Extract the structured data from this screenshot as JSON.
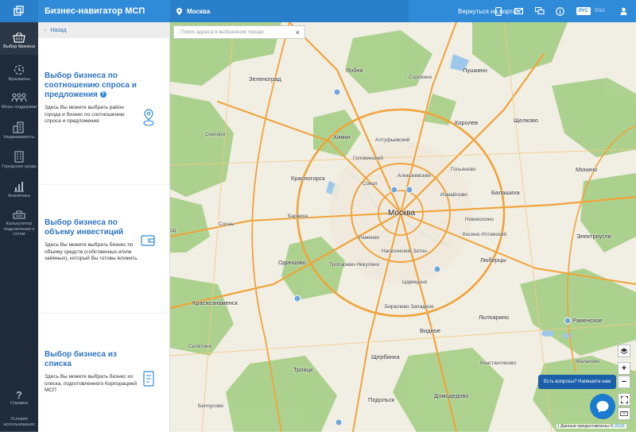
{
  "topbar": {
    "app_title": "Бизнес-навигатор МСП",
    "city": "Москва",
    "back_to_portal": "Вернуться на портал",
    "lang_active": "РУС",
    "lang_inactive": "ENG"
  },
  "sidebar": {
    "items": [
      {
        "label": "Выбор бизнеса"
      },
      {
        "label": "Франшизы"
      },
      {
        "label": "Меры поддержки"
      },
      {
        "label": "Недвижимость"
      },
      {
        "label": "Городская среда"
      },
      {
        "label": "Аналитика"
      },
      {
        "label": "Калькулятор подключения к сетям"
      }
    ],
    "bottom": [
      {
        "label": "Справка"
      },
      {
        "label": "Условия использования"
      }
    ]
  },
  "panel": {
    "back": "Назад",
    "cards": [
      {
        "title": "Выбор бизнеса по соотношению спроса и предложения",
        "desc": "Здесь Вы можете выбрать район города и бизнес по соотношению спроса и предложения"
      },
      {
        "title": "Выбор бизнеса по объему инвестиций",
        "desc": "Здесь Вы можете выбрать бизнес по объему средств (собственных и/или заёмных), который Вы готовы вложить"
      },
      {
        "title": "Выбор бизнеса из списка",
        "desc": "Здесь Вы можете выбрать бизнес из списка, подготовленного Корпорацией МСП"
      }
    ]
  },
  "map": {
    "search_placeholder": "Поиск адреса в выбранном городе",
    "labels": {
      "zelenograd": "Зеленоград",
      "lobnya": "Лобня",
      "sorokino": "Сорокино",
      "pushkino": "Пушкино",
      "snegiri": "Снегири",
      "khimki": "Химки",
      "altufyevsky": "Алтуфьевский",
      "korolev": "Королев",
      "shchelkovo": "Щелково",
      "golovinsky": "Головинский",
      "alekseevsky": "Алексеевский",
      "golyanovo": "Гольяново",
      "monino": "Монино",
      "krasnogorsk": "Красногорск",
      "sokol": "Сокол",
      "izmaylovo": "Измайлово",
      "balashikha": "Балашиха",
      "barvikha": "Барвиха",
      "moskva": "Москва",
      "novokosino": "Новокосино",
      "sosny": "Сосны",
      "kosino": "Косино-Ухтомский",
      "elektrougli": "Электроугли",
      "od": "од",
      "ramenki": "Раменки",
      "odintsovo": "Одинцово",
      "nagatinsky": "Нагатинский Затон",
      "lyubertsy": "Люберцы",
      "troparevo": "Тропарево-Никулино",
      "tsaritsyno": "Царицыно",
      "krasnoznamensk": "Краснознаменск",
      "biryulevo": "Бирюлево Западное",
      "lytkarino": "Лыткарино",
      "ramenskoe": "Раменское",
      "vidnoe": "Видное",
      "selyatino": "Селятино",
      "troitsk": "Троицк",
      "shcherbinka": "Щербинка",
      "konstantinovo": "Константиново",
      "malakhovo": "Малахово",
      "domodedovo": "Домодедово",
      "podolsk": "Подольск",
      "belousovo": "Белоусово"
    },
    "chat_button": "Есть вопросы? Напишите нам",
    "attribution_text": "Данные предоставлены ©",
    "attribution_brand": "2GIS"
  },
  "colors": {
    "topbar": "#2f8ad8",
    "sidebar": "#1f2a3a",
    "title_blue": "#2f74c0",
    "road_orange": "#f0a33a",
    "forest": "#a9d08b",
    "water": "#9dc8ea"
  }
}
